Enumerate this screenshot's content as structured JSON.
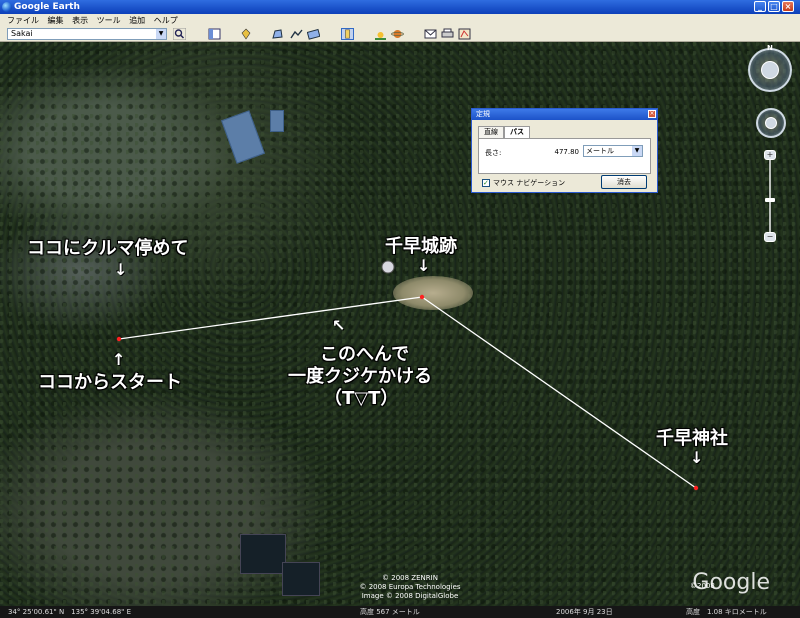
{
  "window": {
    "title": "Google Earth"
  },
  "menu": {
    "items": [
      "ファイル",
      "編集",
      "表示",
      "ツール",
      "追加",
      "ヘルプ"
    ]
  },
  "search": {
    "value": "Sakai"
  },
  "map": {
    "labels": {
      "parking": "ココにクルマ停めて",
      "start": "ココからスタート",
      "castle": "千早城跡",
      "detour_line1": "このへんで",
      "detour_line2": "一度クジケかける",
      "detour_line3": "（T▽T）",
      "shrine": "千早神社"
    },
    "arrows": {
      "down": "↓",
      "up": "↑",
      "diag": "↖"
    },
    "path_color": "#ffffff",
    "marker_color": "#ff2020"
  },
  "ruler": {
    "title": "定規",
    "tabs": [
      "直線",
      "パス"
    ],
    "length_label": "長さ:",
    "length_value": "477.80",
    "unit": "メートル",
    "mouse_nav": "マウス ナビゲーション",
    "clear": "消去"
  },
  "copyright": {
    "line1": "© 2008 ZENRIN",
    "line2": "© 2008 Europa Technologies",
    "line3": "Image © 2008 DigitalGlobe"
  },
  "logo": {
    "year": "©2008",
    "text": "Google"
  },
  "status": {
    "coords": "34° 25'00.61\" N　135° 39'04.68\" E",
    "elevation": "高度 567 メートル",
    "date": "2006年 9月 23日",
    "eye_alt": "高度　1.08 キロメートル"
  }
}
